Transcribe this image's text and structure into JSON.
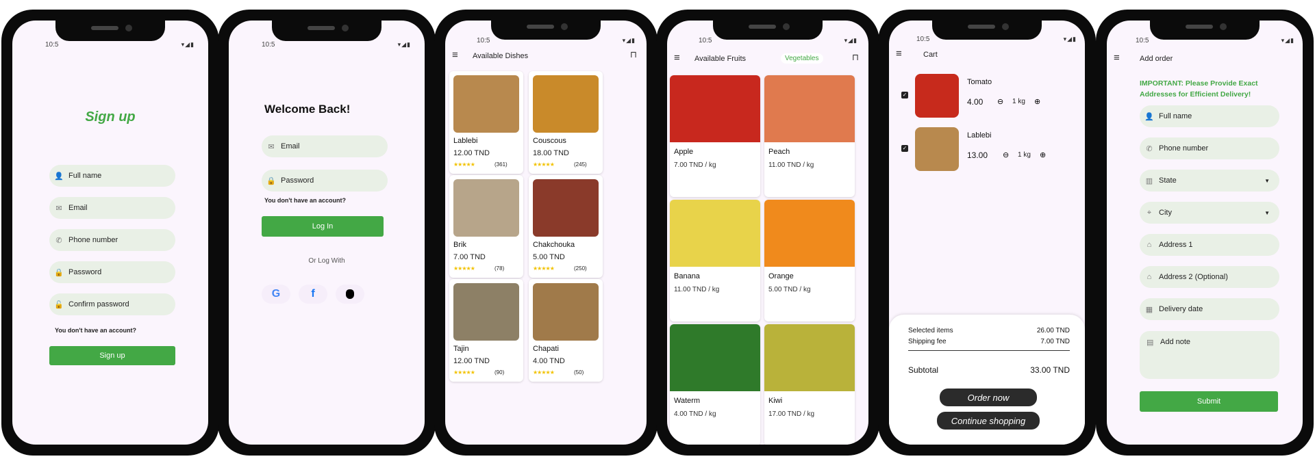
{
  "status": {
    "time": "10:5",
    "icons": "▾◢▮"
  },
  "signup": {
    "title": "Sign up",
    "fields": [
      {
        "icon": "person-icon",
        "glyph": "👤",
        "placeholder": "Full name"
      },
      {
        "icon": "mail-icon",
        "glyph": "✉",
        "placeholder": "Email"
      },
      {
        "icon": "phone-icon",
        "glyph": "✆",
        "placeholder": "Phone number"
      },
      {
        "icon": "lock-icon",
        "glyph": "🔒",
        "placeholder": "Password"
      },
      {
        "icon": "lock-outline-icon",
        "glyph": "🔓",
        "placeholder": "Confirm password"
      }
    ],
    "account_prompt": "You don't have an account?",
    "submit_label": "Sign up"
  },
  "login": {
    "title": "Welcome Back!",
    "email_placeholder": "Email",
    "password_placeholder": "Password",
    "account_prompt": "You don't have an account?",
    "submit_label": "Log In",
    "divider_label": "Or Log With",
    "social": {
      "google": "G",
      "facebook": "f",
      "apple": ""
    }
  },
  "dishes": {
    "title": "Available Dishes",
    "items": [
      {
        "name": "Lablebi",
        "price": "12.00 TND",
        "stars": "★★★★★",
        "count": "(361)"
      },
      {
        "name": "Couscous",
        "price": "18.00 TND",
        "stars": "★★★★★",
        "count": "(245)"
      },
      {
        "name": "Brik",
        "price": "7.00 TND",
        "stars": "★★★★★",
        "count": "(78)"
      },
      {
        "name": "Chakchouka",
        "price": "5.00 TND",
        "stars": "★★★★★",
        "count": "(250)"
      },
      {
        "name": "Tajin",
        "price": "12.00 TND",
        "stars": "★★★★★",
        "count": "(90)"
      },
      {
        "name": "Chapati",
        "price": "4.00 TND",
        "stars": "★★★★★",
        "count": "(50)"
      }
    ]
  },
  "fruits": {
    "title": "Available Fruits",
    "tab_label": "Vegetables",
    "items": [
      {
        "name": "Apple",
        "price": "7.00 TND / kg",
        "color": "#c8281e"
      },
      {
        "name": "Peach",
        "price": "11.00 TND / kg",
        "color": "#e07a4e"
      },
      {
        "name": "Banana",
        "price": "11.00 TND / kg",
        "color": "#e8d34a"
      },
      {
        "name": "Orange",
        "price": "5.00 TND / kg",
        "color": "#f08a1c"
      },
      {
        "name": "Waterm",
        "price": "4.00 TND / kg",
        "color": "#2f7a2a"
      },
      {
        "name": "Kiwi",
        "price": "17.00 TND / kg",
        "color": "#b9b23a"
      }
    ]
  },
  "cart": {
    "title": "Cart",
    "items": [
      {
        "name": "Tomato",
        "price": "4.00",
        "qty": "1 kg"
      },
      {
        "name": "Lablebi",
        "price": "13.00",
        "qty": "1 kg"
      }
    ],
    "selected_label": "Selected items",
    "selected_value": "26.00 TND",
    "shipping_label": "Shipping fee",
    "shipping_value": "7.00 TND",
    "subtotal_label": "Subtotal",
    "subtotal_value": "33.00 TND",
    "order_label": "Order now",
    "continue_label": "Continue shopping"
  },
  "order": {
    "title": "Add order",
    "notice": "IMPORTANT: Please Provide Exact Addresses for Efficient Delivery!",
    "fields": [
      {
        "icon": "person-icon",
        "glyph": "👤",
        "placeholder": "Full name",
        "dropdown": false
      },
      {
        "icon": "phone-icon",
        "glyph": "✆",
        "placeholder": "Phone number",
        "dropdown": false
      },
      {
        "icon": "building-icon",
        "glyph": "▥",
        "placeholder": "State",
        "dropdown": true
      },
      {
        "icon": "location-icon",
        "glyph": "⌖",
        "placeholder": "City",
        "dropdown": true
      },
      {
        "icon": "home-icon",
        "glyph": "⌂",
        "placeholder": "Address 1",
        "dropdown": false
      },
      {
        "icon": "home-outline-icon",
        "glyph": "⌂",
        "placeholder": "Address 2 (Optional)",
        "dropdown": false
      },
      {
        "icon": "calendar-icon",
        "glyph": "▦",
        "placeholder": "Delivery date",
        "dropdown": false
      }
    ],
    "note_placeholder": "Add note",
    "submit_label": "Submit"
  },
  "colors": {
    "accent": "#43a845",
    "screen_bg": "#fbf5fd",
    "pill_bg": "#e9f0e6",
    "star": "#f2c200"
  }
}
